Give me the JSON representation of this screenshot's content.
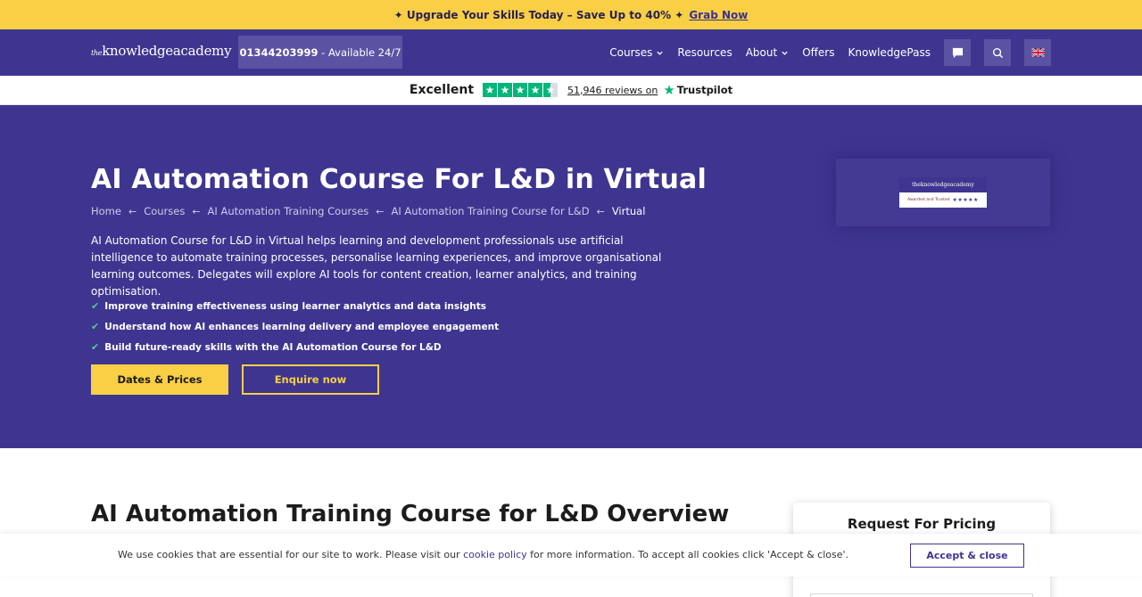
{
  "promo": {
    "text": "✦ Upgrade Your Skills Today – Save Up to 40% ✦",
    "link": "Grab Now"
  },
  "header": {
    "logo_prefix": "the",
    "logo_main": "knowledgeacademy",
    "phone_number": "01344203999",
    "phone_suffix": " - Available 24/7",
    "nav": {
      "courses": "Courses",
      "resources": "Resources",
      "about": "About",
      "offers": "Offers",
      "knowledgepass": "KnowledgePass"
    },
    "icons": {
      "chat": "chat-icon",
      "search": "search-icon",
      "flag": "uk-flag-icon"
    }
  },
  "trustpilot": {
    "rating_word": "Excellent",
    "reviews": "51,946 reviews on",
    "brand": "Trustpilot",
    "stars": 4.5,
    "star_color": "#00b67a"
  },
  "hero": {
    "title": "AI Automation Course For L&D in Virtual",
    "breadcrumbs": [
      "Home",
      "Courses",
      "AI Automation Training Courses",
      "AI Automation Training Course for L&D",
      "Virtual"
    ],
    "description": "AI Automation Course for L&D in Virtual helps learning and development professionals use artificial intelligence to automate training processes, personalise learning experiences, and improve organisational learning outcomes. Delegates will explore AI tools for content creation, learner analytics, and training optimisation.",
    "bullets": [
      "Improve training effectiveness using learner analytics and data insights",
      "Understand how AI enhances learning delivery and employee engagement",
      "Build future-ready skills with the AI Automation Course for L&D"
    ],
    "btn_dates": "Dates & Prices",
    "btn_enquire": "Enquire now",
    "badge_brand": "theknowledgeacademy",
    "badge_tagline": "Awarded and Trusted"
  },
  "overview": {
    "title": "AI Automation Training Course for L&D Overview"
  },
  "pricing": {
    "title": "Request For Pricing"
  },
  "cookie": {
    "text_before": "We use cookies that are essential for our site to work. Please visit our ",
    "link": "cookie policy",
    "text_after": " for more information. To accept all cookies click 'Accept & close'.",
    "button": "Accept & close"
  },
  "colors": {
    "brand_purple": "#3e3590",
    "accent_yellow": "#f8cf45",
    "check_green": "#58c98a"
  }
}
